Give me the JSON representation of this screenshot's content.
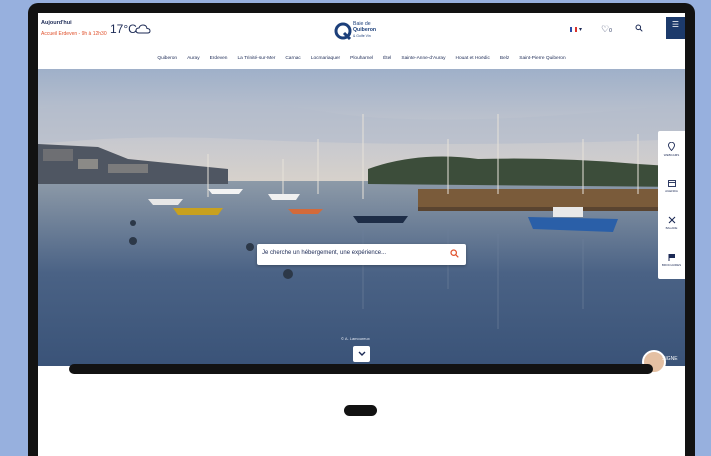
{
  "header": {
    "today_label": "Aujourd'hui",
    "hours": "Accueil Erdeven - 9h à 12h30",
    "temperature": "17°C",
    "weather_icon": "cloud-icon",
    "logo_line1": "Baie de",
    "logo_line2": "Quiberon",
    "logo_line3": "& Golfe Vin",
    "lang_arrow": "▾",
    "fav_count": "0"
  },
  "nav": {
    "items": [
      "Quiberon",
      "Auray",
      "Erdeven",
      "La Trinité-sur-Mer",
      "Carnac",
      "Locmariaquer",
      "Plouharnel",
      "Étel",
      "Sainte-Anne-d'Auray",
      "Houat et Hoëdic",
      "Belz",
      "Saint-Pierre Quiberon"
    ]
  },
  "hero": {
    "search_placeholder": "Je cherche un hébergement, une expérience...",
    "photo_credit": "© A. Lamoureux"
  },
  "side_tools": [
    {
      "icon": "location-pin-icon",
      "label": "WEBCAMS"
    },
    {
      "icon": "calendar-icon",
      "label": "AGENDA"
    },
    {
      "icon": "bike-icon",
      "label": "BALADE"
    },
    {
      "icon": "flag-icon",
      "label": "BROCHURES"
    }
  ],
  "chat": {
    "label": "SIGNE"
  },
  "colors": {
    "navy": "#1c2a55",
    "accent": "#e0522d",
    "frame": "#121212",
    "background": "#97b0de"
  }
}
